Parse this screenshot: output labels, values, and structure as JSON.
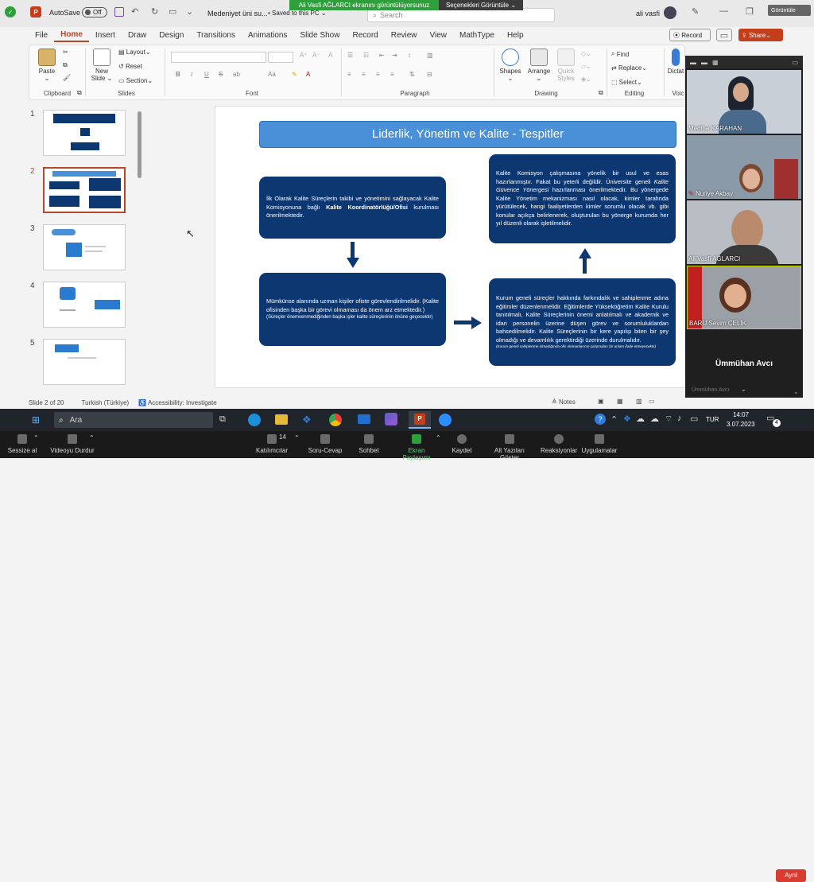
{
  "titlebar": {
    "autosave": "AutoSave",
    "autosave_state": "Off",
    "filename": "Medeniyet üni su...",
    "saved": "Saved to this PC",
    "user": "ali vasfi",
    "search_placeholder": "Search",
    "view_label": "Görüntüle"
  },
  "share_banner": {
    "text": "Ali Vasfi AĞLARCI ekranını görüntülüyorsunuz",
    "options": "Seçenekleri Görüntüle"
  },
  "menu": {
    "tabs": [
      "File",
      "Home",
      "Insert",
      "Draw",
      "Design",
      "Transitions",
      "Animations",
      "Slide Show",
      "Record",
      "Review",
      "View",
      "MathType",
      "Help"
    ],
    "record": "Record",
    "share": "Share"
  },
  "ribbon": {
    "clipboard": {
      "label": "Clipboard",
      "paste": "Paste"
    },
    "slides": {
      "label": "Slides",
      "new_slide": "New Slide",
      "layout": "Layout",
      "reset": "Reset",
      "section": "Section"
    },
    "font": {
      "label": "Font",
      "bold": "B",
      "italic": "I",
      "underline": "U",
      "strike": "S",
      "spacing": "ab"
    },
    "paragraph": {
      "label": "Paragraph"
    },
    "drawing": {
      "label": "Drawing",
      "shapes": "Shapes",
      "arrange": "Arrange",
      "quick_styles": "Quick Styles"
    },
    "editing": {
      "label": "Editing",
      "find": "Find",
      "replace": "Replace",
      "select": "Select"
    },
    "voice": {
      "label": "Voic",
      "dictate": "Dictat"
    }
  },
  "thumbnails": {
    "numbers": [
      "1",
      "2",
      "3",
      "4",
      "5"
    ]
  },
  "slide": {
    "title": "Liderlik, Yönetim ve Kalite - Tespitler",
    "box1_a": "İlk Olarak Kalite Süreçlerin takibi ve yönetimini sağlayacak Kalite Komisyonuna bağlı ",
    "box1_b": "Kalite Koordinatörlüğü/Ofisi",
    "box1_c": " kurulması önerilmektedir.",
    "box2_main": "Mümkünse alanında uzman kişiler ofiste görevlendirilmelidir. (Kalite ofisinden başka bir görevi olmaması da önem arz etmektedir.)",
    "box2_small": "(Süreçler önemsenmediğinden başka işler kalite süreçlerinin önüne geçecektir)",
    "box3_a": "Kalite Komisyon çalışmasına yönelik bir usul ve esas hazırlanmıştır. Fakat bu yeterli değildir. Üniversite geneli ",
    "box3_b": "Kalite Güvence Yönergesi",
    "box3_c": " hazırlanması önerilmektedir. Bu yönergede Kalite Yönetim mekanizması nasıl olacak, kimler tarafında yürütülecek, hangi faaliyetlerden kimler sorumlu olacak vb. gibi konular açıkça belirlenerek, oluşturulan bu yönerge kurumda her yıl düzenli olarak işletilmelidir.",
    "box4_main": "Kurum geneli süreçler hakkında farkındalık ve sahiplenme adına eğitimler düzenlenmelidir. Eğitimlerde Yükseköğretim Kalite Kurulu tanıtılmalı, Kalite Süreçlerinin önemi anlatılmalı ve akademik ve idari personelin üzerine düşen görev ve sorumluluklardan bahsedilmelidir. Kalite Süreçlerinin bir kere yapılıp biten bir şey olmadığı ve devamlılık gerektirdiği üzerinde durulmalıdır.",
    "box4_small": "(Kurum geneli sahiplenme olmadığında ofis elemanlarının çalışmaları bir anlam ifade etmeyecektir)"
  },
  "status": {
    "slide": "Slide 2 of 20",
    "language": "Turkish (Türkiye)",
    "accessibility": "Accessibility: Investigate",
    "notes": "Notes",
    "zoom": "%70"
  },
  "taskbar": {
    "search": "Ara",
    "time": "14:07",
    "date": "3.07.2023",
    "lang": "TUR",
    "notif": "4"
  },
  "zoom_bar": {
    "mute": "Sessize al",
    "video": "Videoyu Durdur",
    "participants": "Katılımcılar",
    "participants_count": "14",
    "qa": "Soru-Cevap",
    "chat": "Sohbet",
    "share": "Ekran Paylaşımı",
    "record": "Kaydet",
    "captions": "Alt Yazıları Göster",
    "reactions": "Reaksiyonlar",
    "apps": "Uygulamalar",
    "leave": "Ayrıl"
  },
  "videos": {
    "p1": "Mediha KARAHAN",
    "p2": "Nuriye Akbay",
    "p3": "Ali Vasfi AĞLARCI",
    "p4": "BARU Sevim ÇELİK",
    "p5": "Ümmühan Avcı",
    "p5_sub": "Ümmühan Avcı"
  },
  "colors": {
    "accent": "#b7472a",
    "slide_box": "#0d3771",
    "slide_header": "#4a90d9",
    "banner_green": "#2e9f3a",
    "leave_red": "#d93b30"
  }
}
